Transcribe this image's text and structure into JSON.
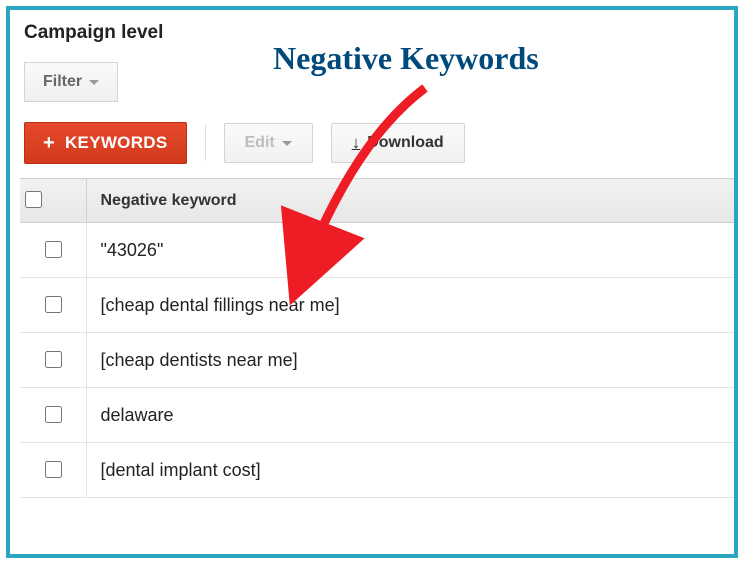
{
  "title": "Campaign level",
  "annotation": "Negative Keywords",
  "filter": {
    "label": "Filter"
  },
  "toolbar": {
    "keywords_label": "KEYWORDS",
    "edit_label": "Edit",
    "download_label": "Download"
  },
  "table": {
    "header": "Negative keyword",
    "rows": [
      {
        "keyword": "\"43026\""
      },
      {
        "keyword": "[cheap dental fillings near me]"
      },
      {
        "keyword": "[cheap dentists near me]"
      },
      {
        "keyword": "delaware"
      },
      {
        "keyword": "[dental implant cost]"
      }
    ]
  }
}
